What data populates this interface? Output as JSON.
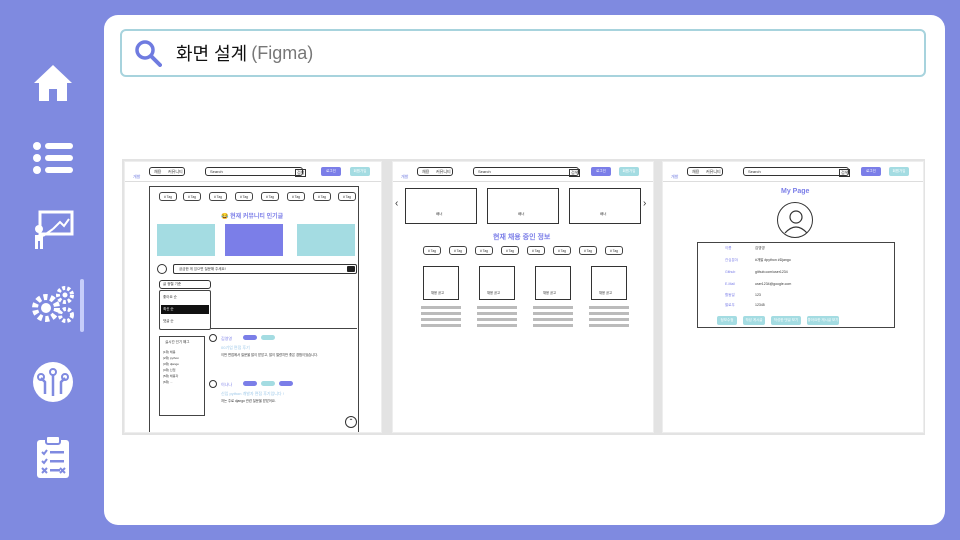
{
  "search": {
    "title": "화면 설계",
    "subtitle": "(Figma)"
  },
  "sidebar": {
    "items": [
      {
        "icon": "home-icon"
      },
      {
        "icon": "list-icon"
      },
      {
        "icon": "presentation-icon"
      },
      {
        "icon": "gears-icon",
        "active": true
      },
      {
        "icon": "circuit-icon"
      },
      {
        "icon": "clipboard-checklist-icon"
      }
    ]
  },
  "colors": {
    "background": "#7f8ae0",
    "panel": "#ffffff",
    "accent_purple": "#7b7ee8",
    "accent_teal": "#a4dce2"
  },
  "shot_community": {
    "logo": "개발",
    "nav": [
      "채용",
      "커뮤니티"
    ],
    "search_placeholder": "Search",
    "search_button": "검색",
    "login": "로그인",
    "signup": "회원가입",
    "tag_label": "# Tag",
    "popular_title": "😂 현재 커뮤니티 인기글",
    "write_prompt": "궁금한 게 있으면 질문해 주세요!",
    "sort_label": "글 정렬 기준",
    "sort_options": [
      "좋아요 순",
      "최신 순",
      "댓글 순"
    ],
    "trending_title": "실시간 인기 해그",
    "trending_items": [
      "[1위] 채용",
      "[2위] python",
      "[3위] django",
      "[4위] 신입",
      "[5위] 채용자",
      "[6위] ..."
    ],
    "posts": [
      {
        "author": "김영영",
        "title": "00기업 면접 후기",
        "body": "이번 면접에서 질문을 많이 받았고, 많이 떨렸지만 좋은 경험이었습니다."
      },
      {
        "author": "이나나",
        "title": "신입 python 개발자 면접 후기입니다 !",
        "body": "저는 주로 django 관련 질문을 받았어요."
      }
    ]
  },
  "shot_jobs": {
    "logo": "개발",
    "nav": [
      "채용",
      "커뮤니티"
    ],
    "search_placeholder": "Search",
    "search_button": "검색",
    "login": "로그인",
    "signup": "회원가입",
    "banner_label": "배너",
    "section_title": "현재 채용 중인 정보",
    "tag_label": "# Tag",
    "job_label": "채용 공고"
  },
  "shot_mypage": {
    "logo": "개발",
    "nav": [
      "채용",
      "커뮤니티"
    ],
    "search_placeholder": "Search",
    "search_button": "검색",
    "login": "로그인",
    "signup": "회원가입",
    "title": "My Page",
    "fields": [
      {
        "label": "이름",
        "value": "김영영"
      },
      {
        "label": "관심분야",
        "value": "#개발  #python  #Django"
      },
      {
        "label": "Github",
        "value": "github.com/user1234"
      },
      {
        "label": "E-Mail",
        "value": "user1234@google.com"
      },
      {
        "label": "활동일",
        "value": "123"
      },
      {
        "label": "팔로우",
        "value": "12345"
      }
    ],
    "buttons": [
      "정보수정",
      "작성 게시글",
      "작성한 댓글 보기",
      "좋아요한 게시글 보기"
    ]
  }
}
